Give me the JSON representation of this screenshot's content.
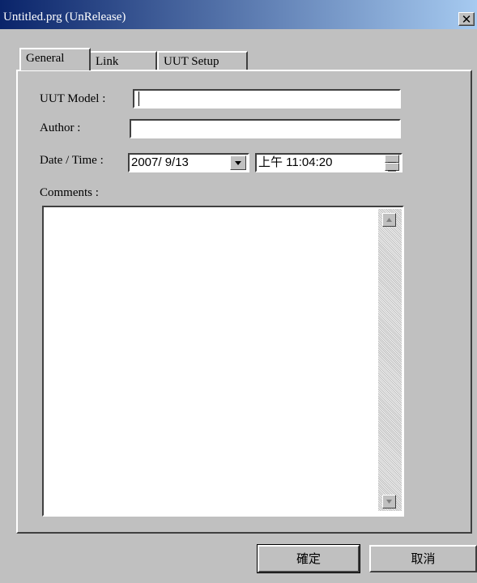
{
  "window": {
    "title": "Untitled.prg (UnRelease)",
    "close_symbol": "✕"
  },
  "tabs": [
    {
      "label": "General",
      "active": true
    },
    {
      "label": "Link",
      "active": false
    },
    {
      "label": "UUT Setup",
      "active": false
    }
  ],
  "form": {
    "uut_model": {
      "label": "UUT Model :",
      "value": ""
    },
    "author": {
      "label": "Author :",
      "value": ""
    },
    "datetime": {
      "label": "Date / Time :",
      "date": "2007/ 9/13",
      "time": "上午 11:04:20"
    },
    "comments": {
      "label": "Comments :",
      "value": ""
    }
  },
  "buttons": {
    "ok": "確定",
    "cancel": "取消"
  },
  "colors": {
    "title_start": "#0a246a",
    "title_end": "#a6caf0",
    "face": "#c0c0c0"
  }
}
